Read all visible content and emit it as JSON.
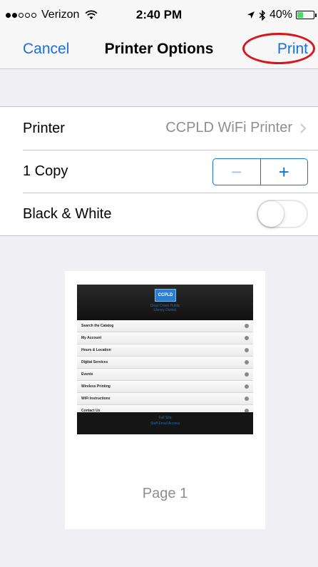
{
  "status": {
    "carrier": "Verizon",
    "time": "2:40 PM",
    "battery_pct": "40%",
    "battery_fill": 0.4,
    "signal_bars_filled": 2,
    "signal_bars_total": 5
  },
  "nav": {
    "cancel_label": "Cancel",
    "title": "Printer Options",
    "print_label": "Print"
  },
  "settings": {
    "printer_label": "Printer",
    "printer_value": "CCPLD WiFi Printer",
    "copies_label": "1 Copy",
    "stepper_minus": "−",
    "stepper_plus": "+",
    "bw_label": "Black & White",
    "bw_enabled": false
  },
  "preview": {
    "logo_text": "CCPLD",
    "library_name_line1": "Clear Creek Public",
    "library_name_line2": "Library District",
    "menu_items": [
      "Search the Catalog",
      "My Account",
      "Hours & Location",
      "Digital Services",
      "Events",
      "Wireless Printing",
      "WiFi Instructions",
      "Contact Us"
    ],
    "footer_line1": "Full Site",
    "footer_line2": "Staff Email Access",
    "page_label": "Page 1"
  },
  "colors": {
    "accent": "#1a6fdc",
    "annotation_circle": "#d9141c",
    "background": "#efeff4"
  }
}
